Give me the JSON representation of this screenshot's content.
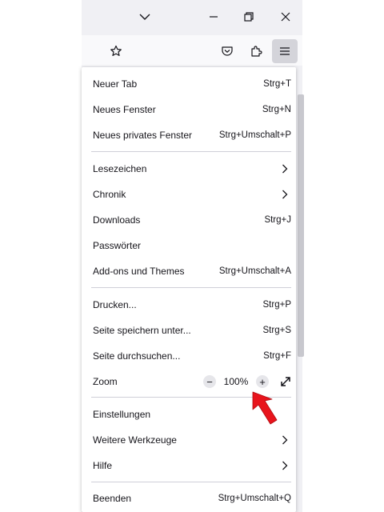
{
  "colors": {
    "accent_arrow": "#e8141c",
    "menu_bg": "#ffffff",
    "chrome_bg": "#f0f0f4"
  },
  "icons": [
    "chevron-down-icon",
    "minimize-icon",
    "restore-icon",
    "close-icon",
    "star-icon",
    "pocket-icon",
    "extensions-icon",
    "hamburger-menu-icon",
    "chevron-right-icon",
    "zoom-out-icon",
    "zoom-in-icon",
    "fullscreen-icon",
    "red-arrow-annotation"
  ],
  "menu": {
    "new_tab": {
      "label": "Neuer Tab",
      "shortcut": "Strg+T"
    },
    "new_window": {
      "label": "Neues Fenster",
      "shortcut": "Strg+N"
    },
    "new_private": {
      "label": "Neues privates Fenster",
      "shortcut": "Strg+Umschalt+P"
    },
    "bookmarks": {
      "label": "Lesezeichen"
    },
    "history": {
      "label": "Chronik"
    },
    "downloads": {
      "label": "Downloads",
      "shortcut": "Strg+J"
    },
    "passwords": {
      "label": "Passwörter"
    },
    "addons": {
      "label": "Add-ons und Themes",
      "shortcut": "Strg+Umschalt+A"
    },
    "print": {
      "label": "Drucken...",
      "shortcut": "Strg+P"
    },
    "save_page": {
      "label": "Seite speichern unter...",
      "shortcut": "Strg+S"
    },
    "find": {
      "label": "Seite durchsuchen...",
      "shortcut": "Strg+F"
    },
    "zoom": {
      "label": "Zoom",
      "minus": "−",
      "value": "100%",
      "plus": "+"
    },
    "settings": {
      "label": "Einstellungen"
    },
    "more_tools": {
      "label": "Weitere Werkzeuge"
    },
    "help": {
      "label": "Hilfe"
    },
    "quit": {
      "label": "Beenden",
      "shortcut": "Strg+Umschalt+Q"
    }
  }
}
